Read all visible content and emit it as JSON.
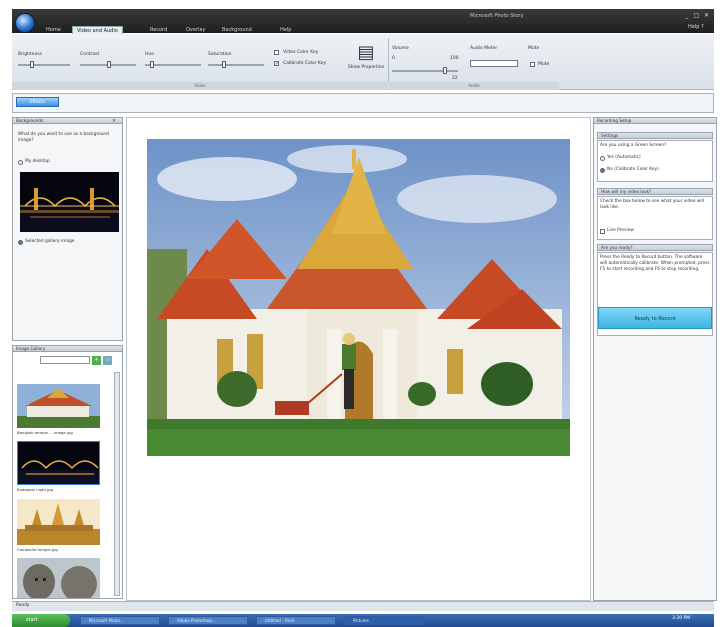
{
  "window": {
    "title": "Microsoft Photo Story",
    "menu_tabs": [
      "Home",
      "Video and Audio",
      "Record",
      "Overlay",
      "Background",
      "Help"
    ],
    "active_tab": "Video and Audio",
    "controls": [
      "_",
      "□",
      "✕"
    ],
    "help_label": "Help ?"
  },
  "ribbon": {
    "sliders": [
      {
        "label": "Brightness",
        "value": 0.25
      },
      {
        "label": "Contrast",
        "value": 0.55
      },
      {
        "label": "Hue",
        "value": 0.15
      },
      {
        "label": "Saturation",
        "value": 0.3
      }
    ],
    "checkboxes": [
      {
        "label": "Video Color Key",
        "checked": false
      },
      {
        "label": "Calibrate Color Key",
        "checked": true
      }
    ],
    "button_show_properties": "Show Properties",
    "group_video": "Video",
    "volume_label": "Volume",
    "volume_min": "0",
    "volume_max": "100",
    "volume_value_label": "22",
    "audio_meter_label": "Audio Meter",
    "mute_label": "Mute",
    "mute_check_label": "Mute",
    "group_audio": "Audio"
  },
  "strip": {
    "button_label": "Effects"
  },
  "left_panel_top": {
    "header": "Backgrounds",
    "question": "What do you want to use as a background image?",
    "option_desktop": "My desktop",
    "option_selected": "Selected gallery image"
  },
  "left_panel_bottom": {
    "header": "Image Gallery",
    "captions": [
      "Bangkok temple ... image.jpg",
      "Budapest night.jpg",
      "Cambodia temple.jpg"
    ]
  },
  "right_panel": {
    "header": "Recording Setup",
    "section1_title": "Settings",
    "section1_q": "Are you using a Green Screen?",
    "section1_opt1": "Yes (Automatic)",
    "section1_opt2": "No (Calibrate Color Key)",
    "section2_title": "How will my video look?",
    "section2_text": "Check the box below to see what your video will look like.",
    "section2_check": "Live Preview",
    "section3_title": "Are you ready?",
    "section3_text": "Press the Ready to Record button. The software will automatically calibrate. When prompted, press F5 to start recording and F6 to stop recording.",
    "ready_button": "Ready to Record"
  },
  "statusbar": {
    "text": "Ready"
  },
  "taskbar": {
    "start": "start",
    "items": [
      "Microsoft Photo...",
      "Adobe Photoshop...",
      "Untitled - Paint",
      "Pictures"
    ],
    "clock": "3:30 PM"
  },
  "colors": {
    "accent": "#3b8fe0",
    "ready_button": "#4bbfe8",
    "titlebar": "#2a2a2a",
    "taskbar": "#2a5aa0",
    "start": "#3ea33e"
  }
}
